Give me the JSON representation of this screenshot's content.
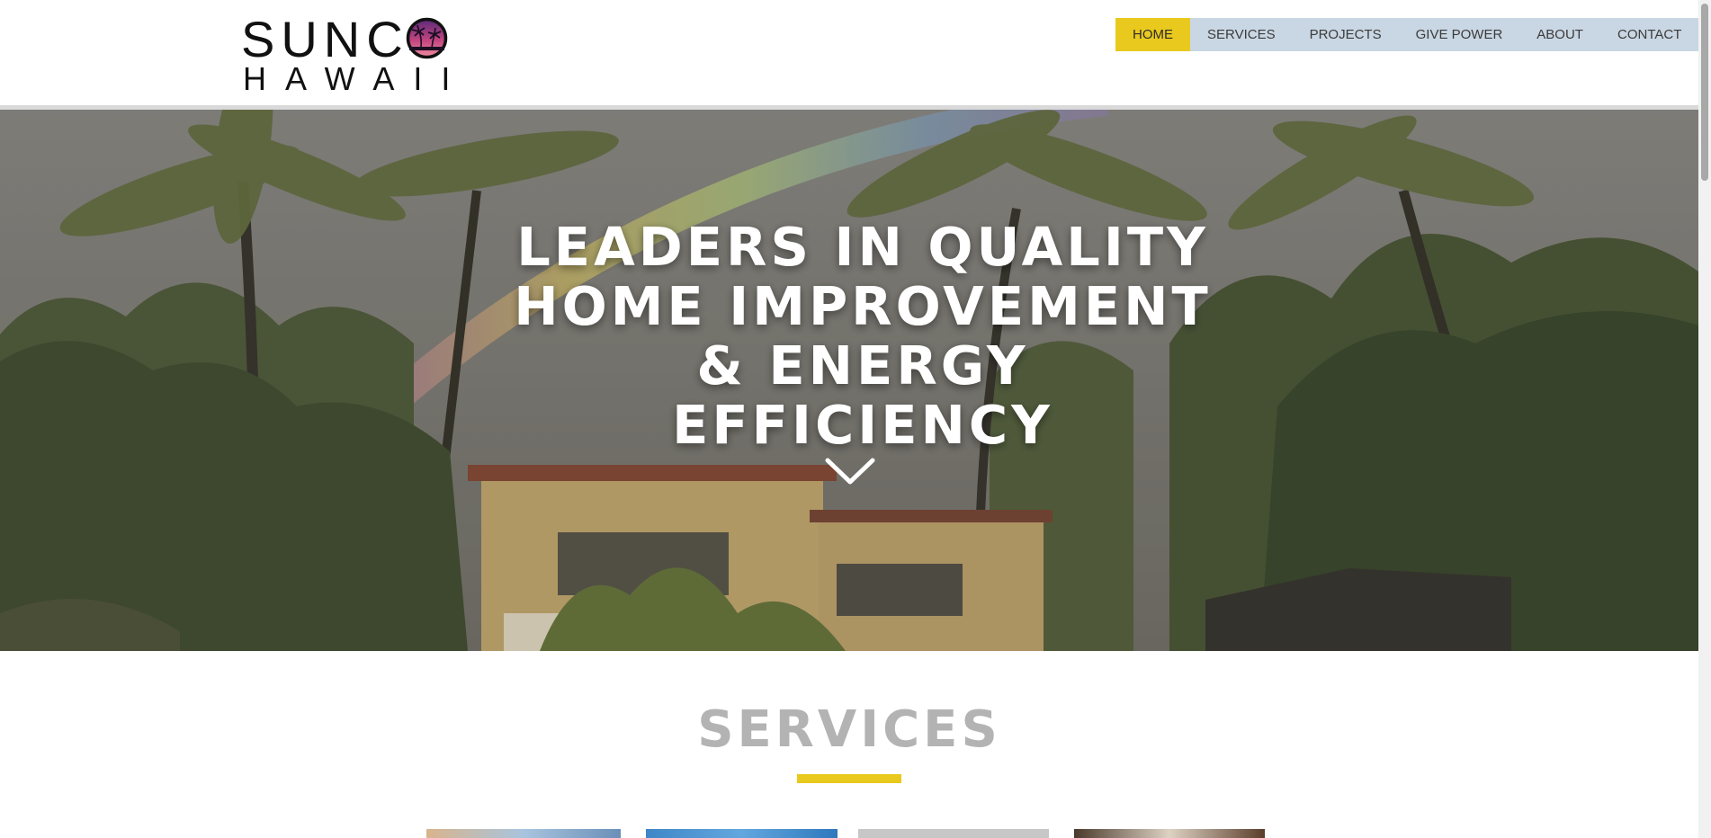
{
  "logo": {
    "line1": "SUNC",
    "line2": "HAWAII",
    "sun_icon": "palm-sunset-icon"
  },
  "nav": {
    "items": [
      {
        "label": "HOME",
        "active": true
      },
      {
        "label": "SERVICES",
        "active": false
      },
      {
        "label": "PROJECTS",
        "active": false
      },
      {
        "label": "GIVE POWER",
        "active": false
      },
      {
        "label": "ABOUT",
        "active": false
      },
      {
        "label": "CONTACT",
        "active": false
      }
    ]
  },
  "hero": {
    "title_lines": [
      "LEADERS IN QUALITY",
      "HOME IMPROVEMENT",
      "& ENERGY",
      "EFFICIENCY"
    ],
    "scroll_icon": "chevron-down-icon"
  },
  "services": {
    "title": "SERVICES"
  },
  "colors": {
    "accent": "#e9c91e",
    "nav_bg": "#c9d6e3",
    "heading_gray": "#b3b3b3"
  }
}
